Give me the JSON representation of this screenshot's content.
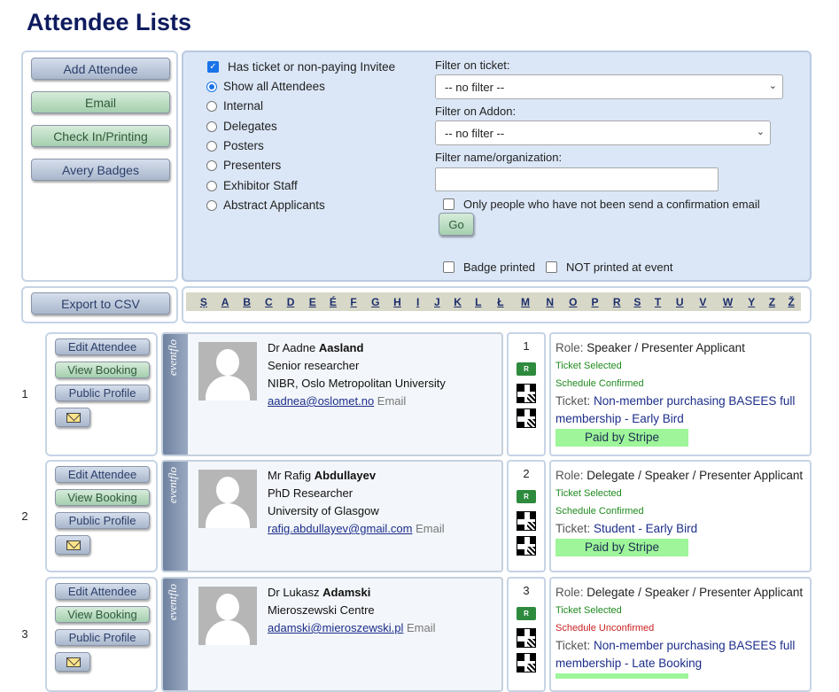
{
  "page": {
    "title": "Attendee Lists"
  },
  "actions": {
    "add_attendee": "Add Attendee",
    "email": "Email",
    "check_in": "Check In/Printing",
    "avery_badges": "Avery Badges",
    "export_csv": "Export to CSV"
  },
  "filters": {
    "has_ticket_label": "Has ticket or non-paying Invitee",
    "has_ticket_checked": true,
    "radios": [
      {
        "label": "Show all Attendees",
        "checked": true
      },
      {
        "label": "Internal",
        "checked": false
      },
      {
        "label": "Delegates",
        "checked": false
      },
      {
        "label": "Posters",
        "checked": false
      },
      {
        "label": "Presenters",
        "checked": false
      },
      {
        "label": "Exhibitor Staff",
        "checked": false
      },
      {
        "label": "Abstract Applicants",
        "checked": false
      }
    ],
    "ticket_label": "Filter on ticket:",
    "ticket_value": "-- no filter --",
    "addon_label": "Filter on Addon:",
    "addon_value": "-- no filter --",
    "name_label": "Filter name/organization:",
    "name_value": "",
    "confirm_email_label": "Only people who have not been send a confirmation email",
    "go_label": "Go",
    "badge_printed_label": "Badge printed",
    "not_printed_label": "NOT printed at event"
  },
  "alphabet": [
    "Ș",
    "A",
    "B",
    "C",
    "D",
    "E",
    "É",
    "F",
    "G",
    "H",
    "I",
    "J",
    "K",
    "L",
    "Ł",
    "M",
    "N",
    "O",
    "P",
    "R",
    "S",
    "T",
    "U",
    "V",
    "W",
    "Y",
    "Z",
    "Ž"
  ],
  "row_actions": {
    "edit": "Edit Attendee",
    "view_booking": "View Booking",
    "public_profile": "Public Profile"
  },
  "brand": "eventflo",
  "attendees": [
    {
      "index": "1",
      "title": "Dr Aadne",
      "surname": "Aasland",
      "position": "Senior researcher",
      "organization": "NIBR, Oslo Metropolitan University",
      "email": "aadnea@oslomet.no",
      "email_label": "Email",
      "count": "1",
      "role_label": "Role:",
      "role": "Speaker / Presenter Applicant",
      "ticket_status": "Ticket Selected",
      "schedule_status": "Schedule Confirmed",
      "ticket_label": "Ticket:",
      "ticket": "Non-member purchasing BASEES full membership - Early Bird",
      "payment": "Paid by Stripe"
    },
    {
      "index": "2",
      "title": "Mr Rafig",
      "surname": "Abdullayev",
      "position": "PhD Researcher",
      "organization": "University of Glasgow",
      "email": "rafig.abdullayev@gmail.com",
      "email_label": "Email",
      "count": "2",
      "role_label": "Role:",
      "role": "Delegate / Speaker / Presenter Applicant",
      "ticket_status": "Ticket Selected",
      "schedule_status": "Schedule Confirmed",
      "ticket_label": "Ticket:",
      "ticket": "Student - Early Bird",
      "payment": "Paid by Stripe"
    },
    {
      "index": "3",
      "title": "Dr Lukasz",
      "surname": "Adamski",
      "position": "Mieroszewski Centre",
      "organization": "",
      "email": "adamski@mieroszewski.pl",
      "email_label": "Email",
      "count": "3",
      "role_label": "Role:",
      "role": "Delegate / Speaker / Presenter Applicant",
      "ticket_status": "Ticket Selected",
      "schedule_status": "Schedule Unconfirmed",
      "ticket_label": "Ticket:",
      "ticket": "Non-member purchasing BASEES full membership - Late Booking",
      "payment": ""
    }
  ]
}
